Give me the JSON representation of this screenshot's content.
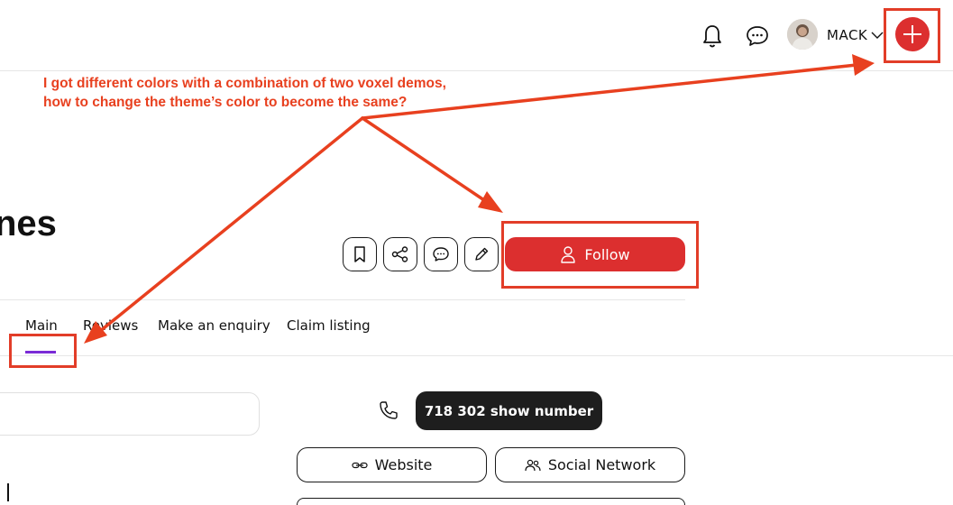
{
  "header": {
    "username": "MACK",
    "accent_color": "#dc2f2f"
  },
  "page": {
    "title_fragment": "nes"
  },
  "actions": {
    "follow_label": "Follow"
  },
  "tabs": [
    {
      "label": "Main",
      "active": true
    },
    {
      "label": "Reviews",
      "active": false
    },
    {
      "label": "Make an enquiry",
      "active": false
    },
    {
      "label": "Claim listing",
      "active": false
    }
  ],
  "tab_indicator_color": "#7a2bd6",
  "contact": {
    "phone_button": "718 302 show number",
    "website_button": "Website",
    "social_button": "Social Network"
  },
  "annotation": {
    "line1": "I got different colors with a combination of two voxel demos,",
    "line2": "how to change the theme’s color to become the same?",
    "color": "#e23d28"
  }
}
